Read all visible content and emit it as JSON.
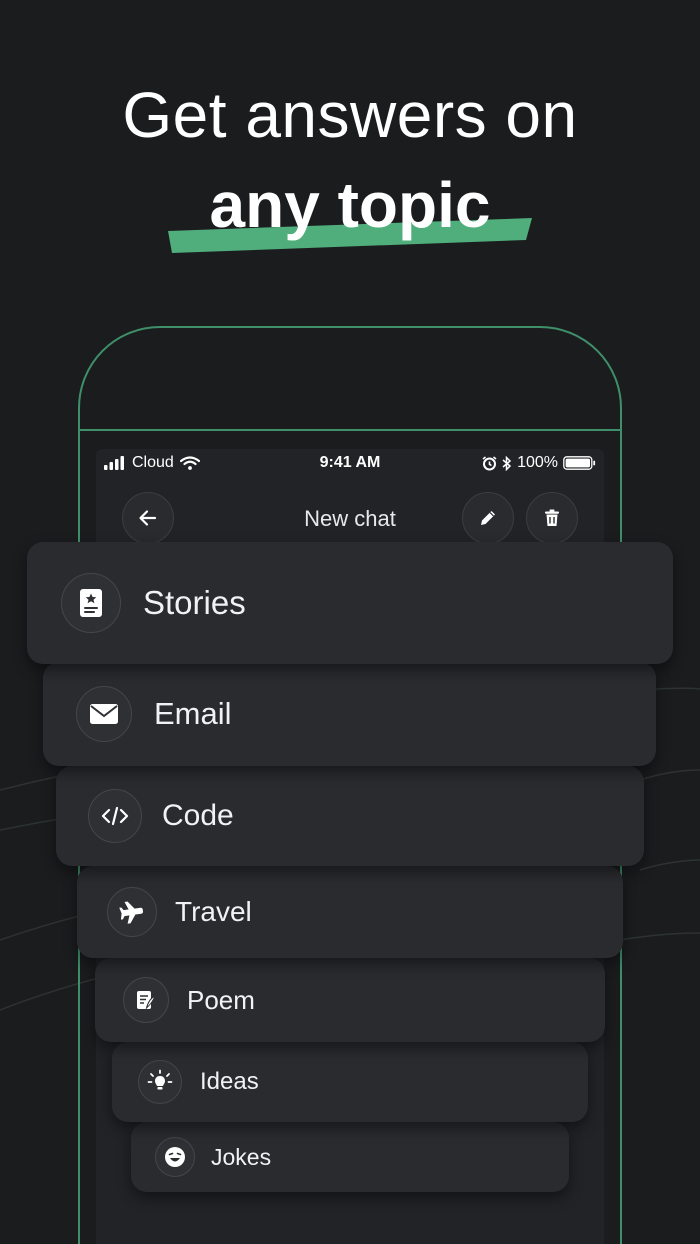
{
  "headline": {
    "line1": "Get answers on",
    "line2": "any topic"
  },
  "colors": {
    "background": "#1b1c1e",
    "accent": "#4fae7c",
    "card": "#2a2b2f",
    "phone_outline": "#3f8f6b"
  },
  "statusbar": {
    "carrier": "Cloud",
    "time": "9:41 AM",
    "battery": "100%"
  },
  "navbar": {
    "title": "New chat",
    "back_icon": "arrow-left-icon",
    "edit_icon": "pencil-icon",
    "delete_icon": "trash-icon"
  },
  "topics": [
    {
      "label": "Stories",
      "icon": "book-star-icon"
    },
    {
      "label": "Email",
      "icon": "envelope-icon"
    },
    {
      "label": "Code",
      "icon": "code-icon"
    },
    {
      "label": "Travel",
      "icon": "airplane-icon"
    },
    {
      "label": "Poem",
      "icon": "quill-page-icon"
    },
    {
      "label": "Ideas",
      "icon": "lightbulb-icon"
    },
    {
      "label": "Jokes",
      "icon": "laughing-face-icon"
    }
  ]
}
